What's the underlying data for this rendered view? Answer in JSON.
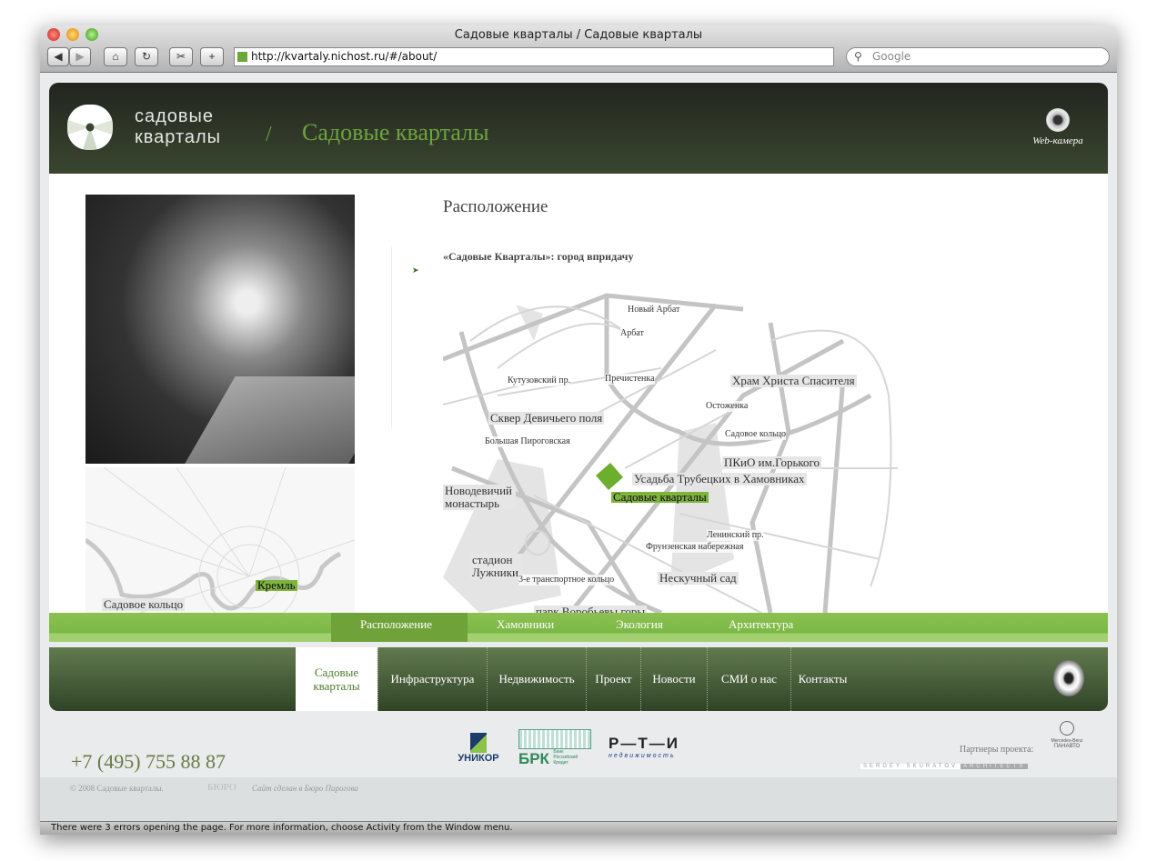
{
  "browser": {
    "title": "Садовые кварталы / Садовые кварталы",
    "url": "http://kvartaly.nichost.ru/#/about/",
    "search_placeholder": "Google",
    "status": "There were 3 errors opening the page. For more information, choose Activity from the Window menu."
  },
  "header": {
    "logo_line1": "садовые",
    "logo_line2": "кварталы",
    "separator": "/",
    "title": "Садовые кварталы",
    "webcam": "Web-камера"
  },
  "content": {
    "heading": "Расположение",
    "subheading": "«Садовые Кварталы»: город впридачу"
  },
  "map": {
    "labels": [
      "Новый Арбат",
      "Арбат",
      "Кутузовский пр.",
      "Пречистенка",
      "Храм Христа Спасителя",
      "Остоженка",
      "Сквер Девичьего поля",
      "Садовое кольцо",
      "Большая Пироговская",
      "ПКиО им.Горького",
      "Усадьба Трубецких в Хамовниках",
      "Садовые кварталы",
      "Новодевичий монастырь",
      "Ленинский пр.",
      "Фрунзенская набережная",
      "стадион Лужники",
      "3-е транспортное кольцо",
      "Нескучный сад",
      "парк Воробьевы горы"
    ]
  },
  "minimap": {
    "labels": [
      "Кремль",
      "Садовое кольцо"
    ]
  },
  "subnav": [
    "Расположение",
    "Хамовники",
    "Экология",
    "Архитектура"
  ],
  "mainnav": [
    "Садовые кварталы",
    "Инфраструктура",
    "Недвижимость",
    "Проект",
    "Новости",
    "СМИ о нас",
    "Контакты"
  ],
  "footer": {
    "phone": "+7 (495)  755 88 87",
    "partners_label": "Партнеры проекта:",
    "copyright": "© 2008 Садовые кварталы.",
    "credit": "Сайт сделан в Бюро Пирогова",
    "logos": [
      "УНИКОР",
      "БРК",
      "Банк Российский Кредит",
      "Р—Т—И",
      "недвижимость",
      "БЮРО",
      "Mercedes-Benz",
      "ПАНАВТО",
      "SERGEY SKURATOV",
      "ARCHITECTS"
    ]
  }
}
